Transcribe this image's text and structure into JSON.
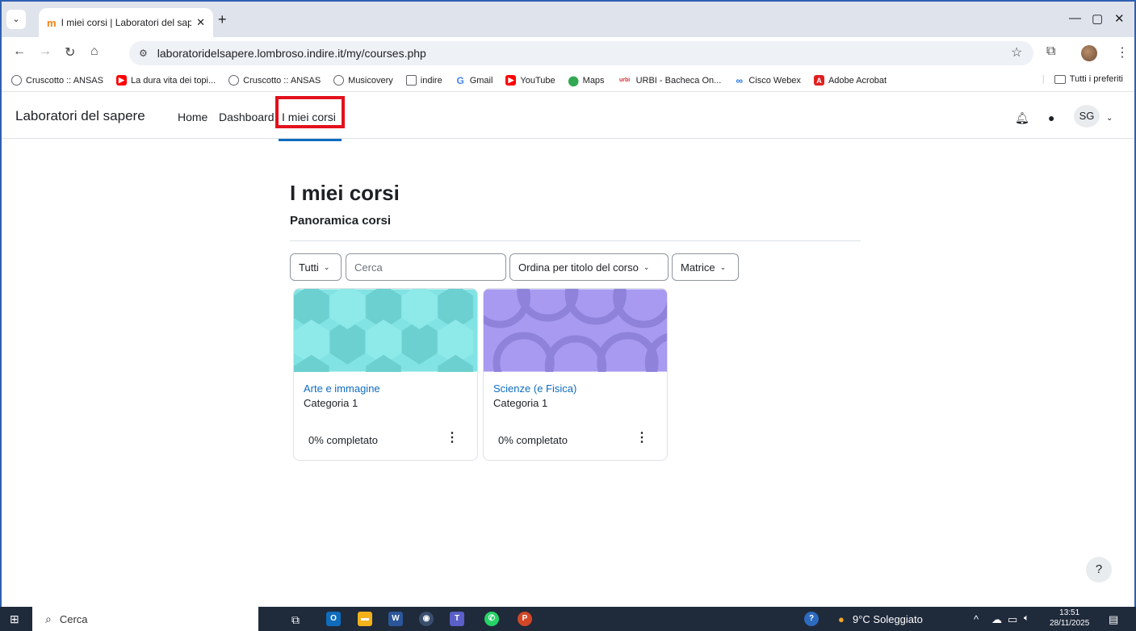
{
  "browser": {
    "tab_menu_glyph": "⌄",
    "tab_title": "I miei corsi | Laboratori del sape",
    "tab_close": "✕",
    "new_tab": "+",
    "url": "laboratoridelsapere.lombroso.indire.it/my/courses.php",
    "bookmarks": [
      {
        "label": "Cruscotto :: ANSAS",
        "icon": "globe-icon",
        "color": "#5f6368"
      },
      {
        "label": "La dura vita dei topi...",
        "icon": "youtube-icon",
        "color": "#ff0000"
      },
      {
        "label": "Cruscotto :: ANSAS",
        "icon": "globe-icon",
        "color": "#5f6368"
      },
      {
        "label": "Musicovery",
        "icon": "globe-icon",
        "color": "#5f6368"
      },
      {
        "label": "indire",
        "icon": "folder-icon",
        "color": "#5f6368"
      },
      {
        "label": "Gmail",
        "icon": "google-icon",
        "color": "#4285f4"
      },
      {
        "label": "YouTube",
        "icon": "youtube-icon",
        "color": "#ff0000"
      },
      {
        "label": "Maps",
        "icon": "maps-icon",
        "color": "#34a853"
      },
      {
        "label": "URBI - Bacheca On...",
        "icon": "urbi-icon",
        "color": "#d32f2f"
      },
      {
        "label": "Cisco Webex",
        "icon": "webex-icon",
        "color": "#1a73e8"
      },
      {
        "label": "Adobe Acrobat",
        "icon": "acrobat-icon",
        "color": "#e02020"
      }
    ],
    "all_bookmarks": "Tutti i preferiti"
  },
  "moodle": {
    "brand": "Laboratori del sapere",
    "nav": [
      "Home",
      "Dashboard",
      "I miei corsi"
    ],
    "user_initials": "SG"
  },
  "main": {
    "title": "I miei corsi",
    "section": "Panoramica corsi",
    "filter_all": "Tutti",
    "search_placeholder": "Cerca",
    "sort_label": "Ordina per titolo del corso",
    "view_label": "Matrice",
    "courses": [
      {
        "name": "Arte e immagine",
        "category": "Categoria 1",
        "progress": "0% completato",
        "color": "#81e3e3"
      },
      {
        "name": "Scienze (e Fisica)",
        "category": "Categoria 1",
        "progress": "0% completato",
        "color": "#a79af0"
      }
    ],
    "help": "?"
  },
  "taskbar": {
    "search": "Cerca",
    "weather": "9°C Soleggiato",
    "time": "13:51",
    "date": "28/11/2025"
  }
}
